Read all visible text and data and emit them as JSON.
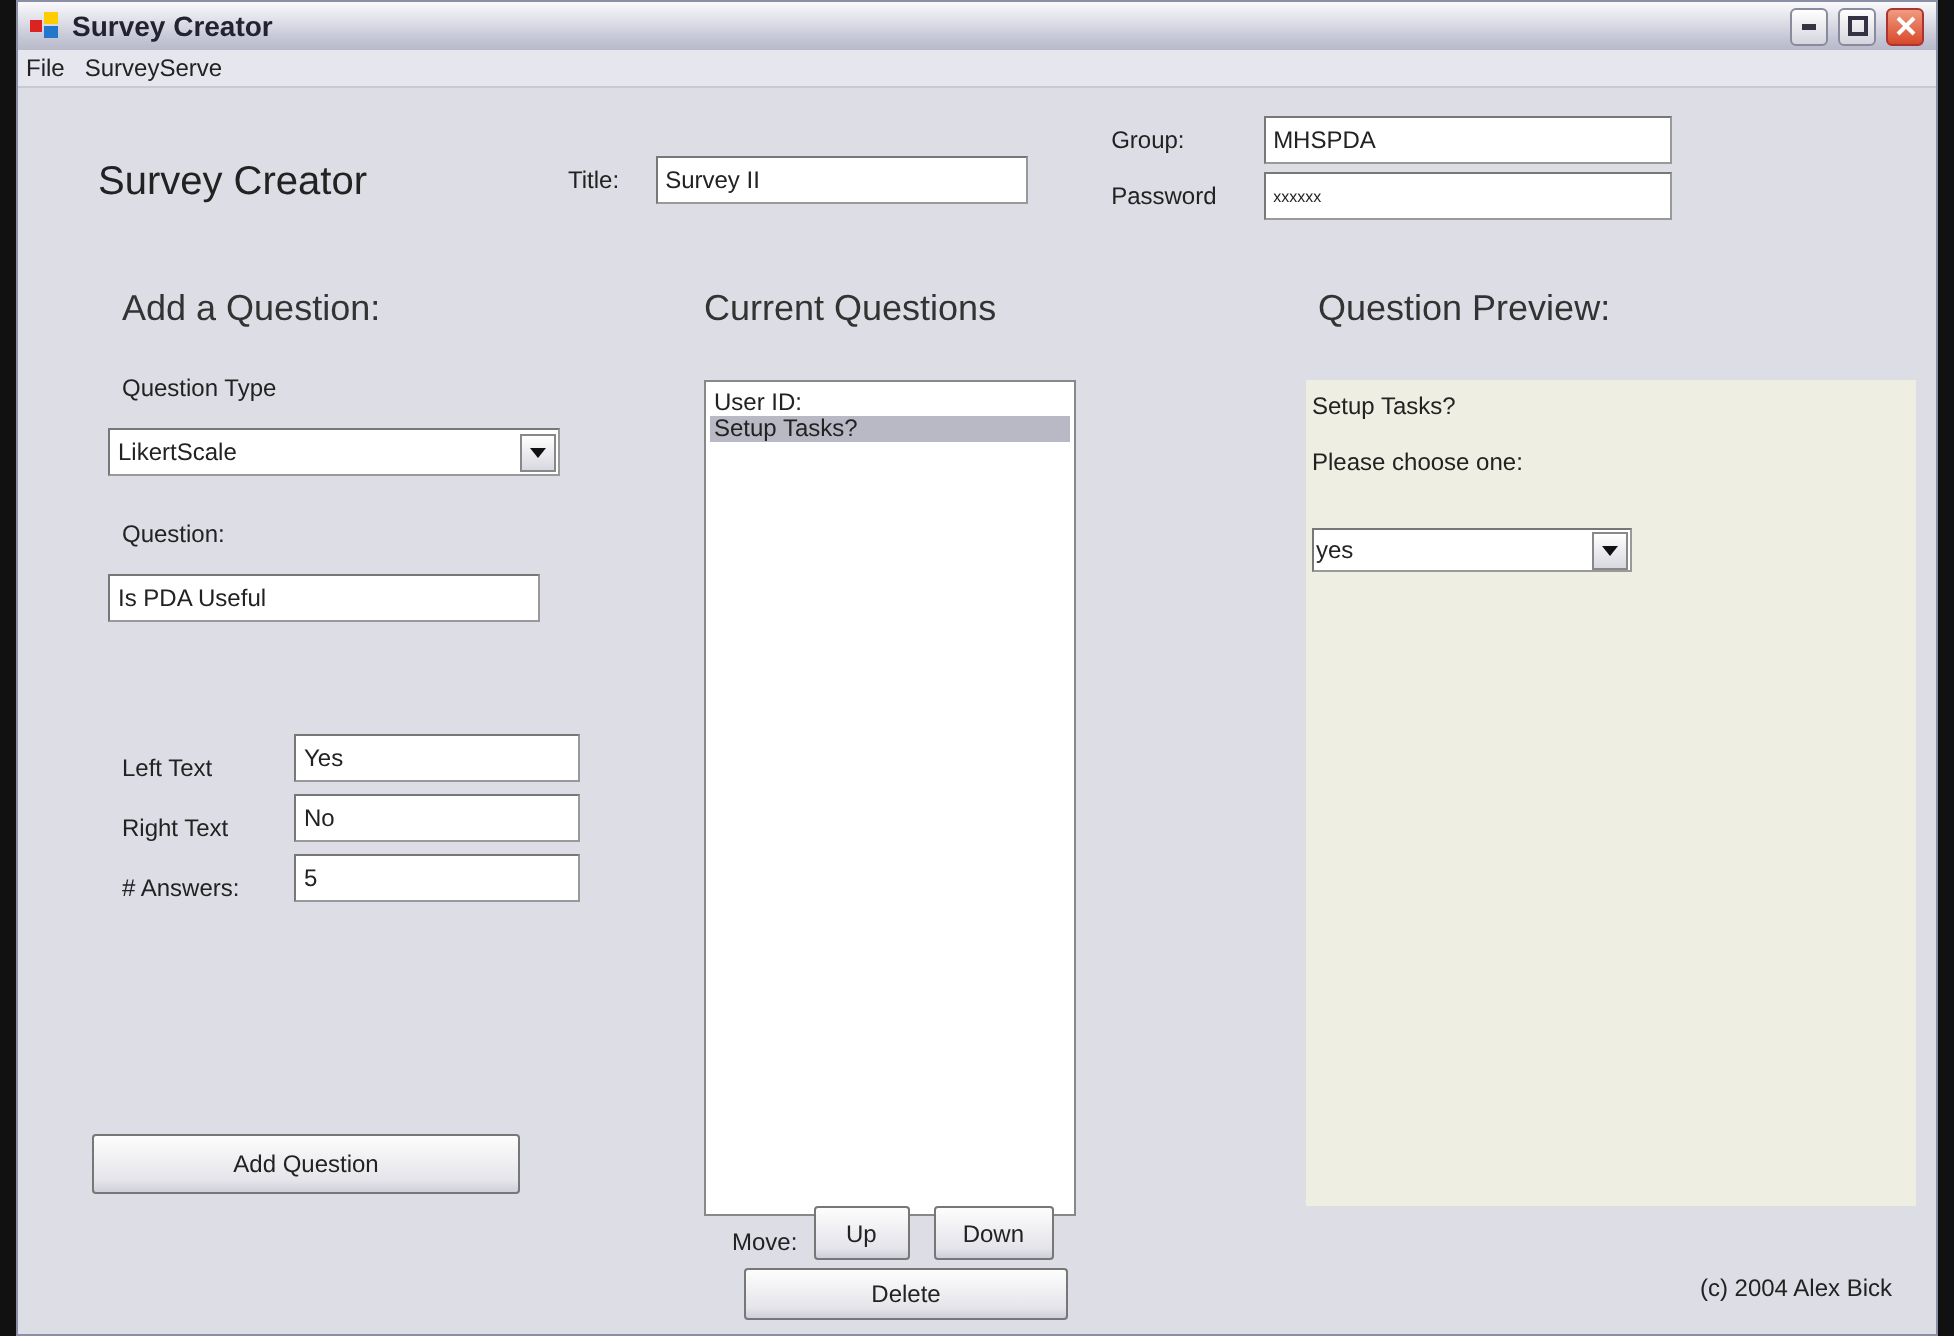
{
  "window": {
    "title": "Survey Creator"
  },
  "menu": [
    {
      "label": "File"
    },
    {
      "label": "SurveyServe"
    }
  ],
  "header": {
    "app_title": "Survey Creator",
    "title_label": "Title:",
    "title_value": "Survey II",
    "group_label": "Group:",
    "group_value": "MHSPDA",
    "password_label": "Password",
    "password_value": "xxxxxx"
  },
  "add_question": {
    "heading": "Add a Question:",
    "type_label": "Question Type",
    "type_value": "LikertScale",
    "question_label": "Question:",
    "question_value": "Is PDA Useful",
    "fields": [
      {
        "label": "Left Text",
        "value": "Yes"
      },
      {
        "label": "Right Text",
        "value": "No"
      },
      {
        "label": "# Answers:",
        "value": "5"
      }
    ],
    "button": "Add Question"
  },
  "current_questions": {
    "heading": "Current Questions",
    "items": [
      {
        "label": "User ID:",
        "selected": false
      },
      {
        "label": "Setup Tasks?",
        "selected": true
      }
    ],
    "move_label": "Move:",
    "up": "Up",
    "down": "Down",
    "delete": "Delete"
  },
  "preview": {
    "heading": "Question Preview:",
    "question": "Setup Tasks?",
    "prompt": "Please choose one:",
    "choice": "yes"
  },
  "footer": "(c) 2004 Alex Bick"
}
